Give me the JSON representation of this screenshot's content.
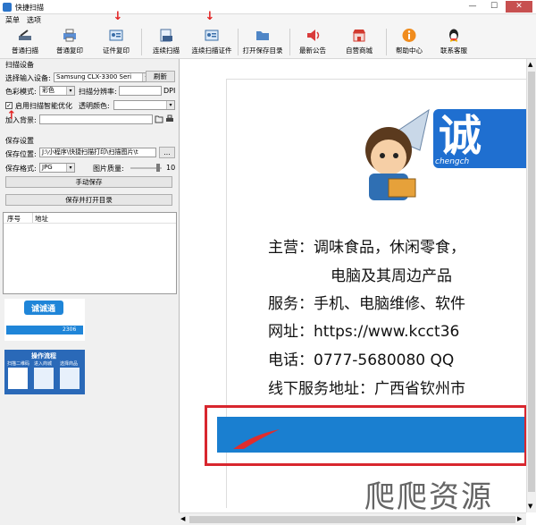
{
  "window": {
    "title": "快捷扫描",
    "min": "—",
    "max": "☐",
    "close": "✕"
  },
  "menu": [
    "菜单",
    "选项"
  ],
  "toolbar": [
    {
      "label": "普通扫描",
      "icon": "scanner-icon"
    },
    {
      "label": "普通复印",
      "icon": "printer-icon"
    },
    {
      "label": "证件复印",
      "icon": "id-card-icon"
    },
    {
      "label": "连续扫描",
      "icon": "continuous-scan-icon"
    },
    {
      "label": "连续扫描证件",
      "icon": "id-card-scan-icon"
    },
    {
      "label": "打开保存目录",
      "icon": "folder-icon"
    },
    {
      "label": "最新公告",
      "icon": "speaker-icon"
    },
    {
      "label": "自营商城",
      "icon": "shop-icon"
    },
    {
      "label": "帮助中心",
      "icon": "info-icon"
    },
    {
      "label": "联系客服",
      "icon": "qq-icon"
    }
  ],
  "scan": {
    "group": "扫描设备",
    "device_label": "选择输入设备:",
    "device_value": "Samsung CLX-3300 Seri",
    "refresh": "刷新",
    "color_label": "色彩模式:",
    "color_value": "彩色",
    "res_label": "扫描分辨率:",
    "res_unit": "DPI",
    "remove_bg": "启用扫描智能优化",
    "transparent_label": "透明颜色:",
    "add_bg_label": "加入背景:"
  },
  "save": {
    "group": "保存设置",
    "path_label": "保存位置:",
    "path_value": "J:\\小程序\\快捷扫描打印\\扫描图片\\t",
    "browse": "...",
    "format_label": "保存格式:",
    "format_value": "JPG",
    "quality_label": "图片质量:",
    "quality_value": "10",
    "quality_level": 0.95,
    "manual_save": "手动保存",
    "save_open": "保存并打开目录"
  },
  "list": {
    "col_no": "序号",
    "col_addr": "地址"
  },
  "thumb1": {
    "brand": "诚诚通",
    "tag": "2306"
  },
  "thumb2": {
    "title": "操作流程",
    "sub1": "扫描二维码",
    "sub2": "进入商城",
    "sub3": "选择商品"
  },
  "doc": {
    "brand": "诚",
    "brand_pinyin": "chengch",
    "lines": [
      "主营：调味食品，休闲零食，",
      "电脑及其周边产品",
      "服务：手机、电脑维修、软件",
      "网址：https://www.kcct36",
      "电话：0777-5680080  QQ",
      "线下服务地址：广西省钦州市"
    ]
  },
  "watermark": "爬爬资源",
  "colors": {
    "accent_red": "#d8262e",
    "band_blue": "#1a7fd0"
  }
}
